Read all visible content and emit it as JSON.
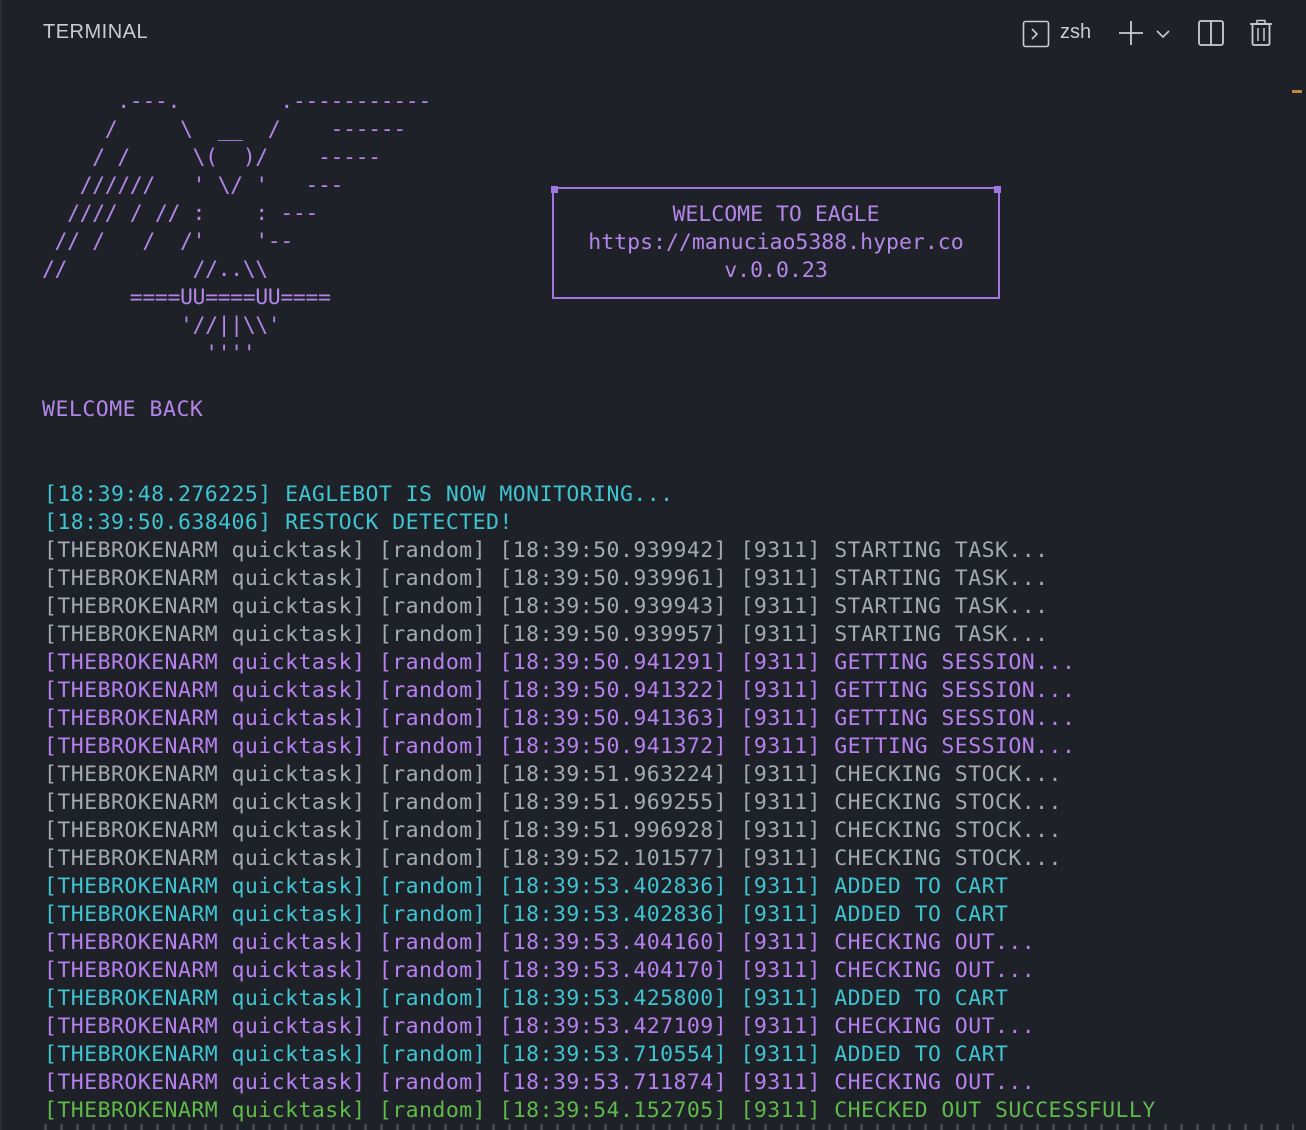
{
  "panel": {
    "title": "TERMINAL",
    "shell": "zsh",
    "icons": [
      "terminal-icon",
      "plus-icon",
      "chevron-down-icon",
      "split-icon",
      "trash-icon"
    ]
  },
  "banner": {
    "ascii_art": [
      "      .---.        .-----------",
      "     /     \\  __  /    ------",
      "    / /     \\(  )/    -----",
      "   //////   ' \\/ '   ---",
      "  //// / // :    : ---",
      " // /   /  /'    '--",
      "//          //..\\\\",
      "       ====UU====UU====",
      "           '//||\\\\'",
      "             ''''"
    ],
    "box_lines": [
      "WELCOME TO EAGLE",
      "https://manuciao5388.hyper.co",
      "v.0.0.23"
    ]
  },
  "welcome_back": "WELCOME BACK",
  "log": [
    {
      "color": "cyan",
      "text": "[18:39:48.276225] EAGLEBOT IS NOW MONITORING..."
    },
    {
      "color": "cyan",
      "text": "[18:39:50.638406] RESTOCK DETECTED!"
    },
    {
      "color": "gray",
      "text": "[THEBROKENARM quicktask] [random] [18:39:50.939942] [9311] STARTING TASK..."
    },
    {
      "color": "gray",
      "text": "[THEBROKENARM quicktask] [random] [18:39:50.939961] [9311] STARTING TASK..."
    },
    {
      "color": "gray",
      "text": "[THEBROKENARM quicktask] [random] [18:39:50.939943] [9311] STARTING TASK..."
    },
    {
      "color": "gray",
      "text": "[THEBROKENARM quicktask] [random] [18:39:50.939957] [9311] STARTING TASK..."
    },
    {
      "color": "purple",
      "text": "[THEBROKENARM quicktask] [random] [18:39:50.941291] [9311] GETTING SESSION..."
    },
    {
      "color": "purple",
      "text": "[THEBROKENARM quicktask] [random] [18:39:50.941322] [9311] GETTING SESSION..."
    },
    {
      "color": "purple",
      "text": "[THEBROKENARM quicktask] [random] [18:39:50.941363] [9311] GETTING SESSION..."
    },
    {
      "color": "purple",
      "text": "[THEBROKENARM quicktask] [random] [18:39:50.941372] [9311] GETTING SESSION..."
    },
    {
      "color": "gray",
      "text": "[THEBROKENARM quicktask] [random] [18:39:51.963224] [9311] CHECKING STOCK..."
    },
    {
      "color": "gray",
      "text": "[THEBROKENARM quicktask] [random] [18:39:51.969255] [9311] CHECKING STOCK..."
    },
    {
      "color": "gray",
      "text": "[THEBROKENARM quicktask] [random] [18:39:51.996928] [9311] CHECKING STOCK..."
    },
    {
      "color": "gray",
      "text": "[THEBROKENARM quicktask] [random] [18:39:52.101577] [9311] CHECKING STOCK..."
    },
    {
      "color": "cyan",
      "text": "[THEBROKENARM quicktask] [random] [18:39:53.402836] [9311] ADDED TO CART"
    },
    {
      "color": "cyan",
      "text": "[THEBROKENARM quicktask] [random] [18:39:53.402836] [9311] ADDED TO CART"
    },
    {
      "color": "purple",
      "text": "[THEBROKENARM quicktask] [random] [18:39:53.404160] [9311] CHECKING OUT..."
    },
    {
      "color": "purple",
      "text": "[THEBROKENARM quicktask] [random] [18:39:53.404170] [9311] CHECKING OUT..."
    },
    {
      "color": "cyan",
      "text": "[THEBROKENARM quicktask] [random] [18:39:53.425800] [9311] ADDED TO CART"
    },
    {
      "color": "purple",
      "text": "[THEBROKENARM quicktask] [random] [18:39:53.427109] [9311] CHECKING OUT..."
    },
    {
      "color": "cyan",
      "text": "[THEBROKENARM quicktask] [random] [18:39:53.710554] [9311] ADDED TO CART"
    },
    {
      "color": "purple",
      "text": "[THEBROKENARM quicktask] [random] [18:39:53.711874] [9311] CHECKING OUT..."
    },
    {
      "color": "green",
      "text": "[THEBROKENARM quicktask] [random] [18:39:54.152705] [9311] CHECKED OUT SUCCESSFULLY"
    }
  ],
  "colors": {
    "background": "#1e2128",
    "cyan": "#3fc4d2",
    "gray": "#a4a9b0",
    "purple": "#b680ef",
    "green": "#5fba4a",
    "accent": "#a276e0"
  }
}
